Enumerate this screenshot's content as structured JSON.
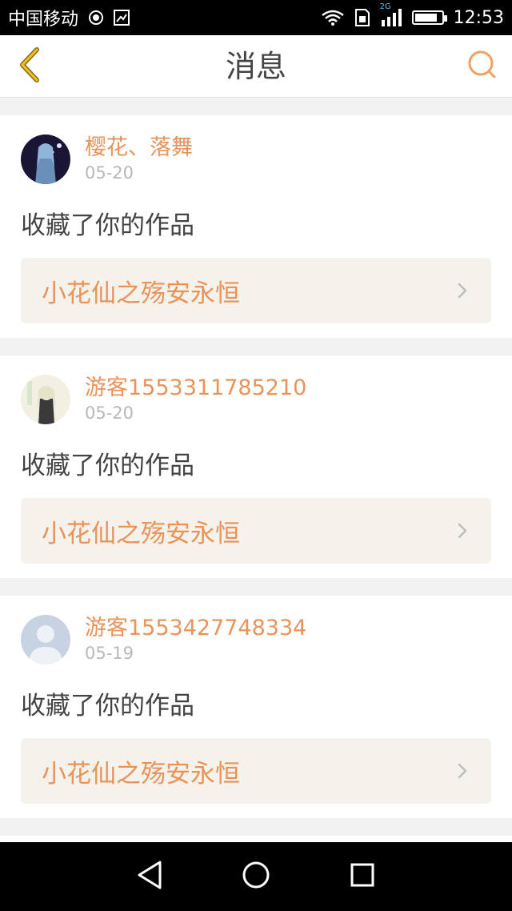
{
  "status_bar": {
    "carrier": "中国移动",
    "network_label": "2G",
    "time": "12:53",
    "battery_level": 0.85,
    "icons": [
      "hd-voice-icon",
      "photo-icon",
      "wifi-icon",
      "sim-icon",
      "signal-icon",
      "battery-icon"
    ]
  },
  "header": {
    "title": "消息",
    "back_icon": "chevron-left-icon",
    "search_icon": "search-icon",
    "accent_color": "#e8935a"
  },
  "messages": [
    {
      "username": "樱花、落舞",
      "date": "05-20",
      "action": "收藏了你的作品",
      "work_title": "小花仙之殇安永恒",
      "avatar": "anime-girl-dark"
    },
    {
      "username": "游客1553311785210",
      "date": "05-20",
      "action": "收藏了你的作品",
      "work_title": "小花仙之殇安永恒",
      "avatar": "anime-girl-light"
    },
    {
      "username": "游客1553427748334",
      "date": "05-19",
      "action": "收藏了你的作品",
      "work_title": "小花仙之殇安永恒",
      "avatar": "default-avatar"
    }
  ],
  "nav_bar": {
    "icons": [
      "back-triangle-icon",
      "home-circle-icon",
      "recents-square-icon"
    ]
  }
}
